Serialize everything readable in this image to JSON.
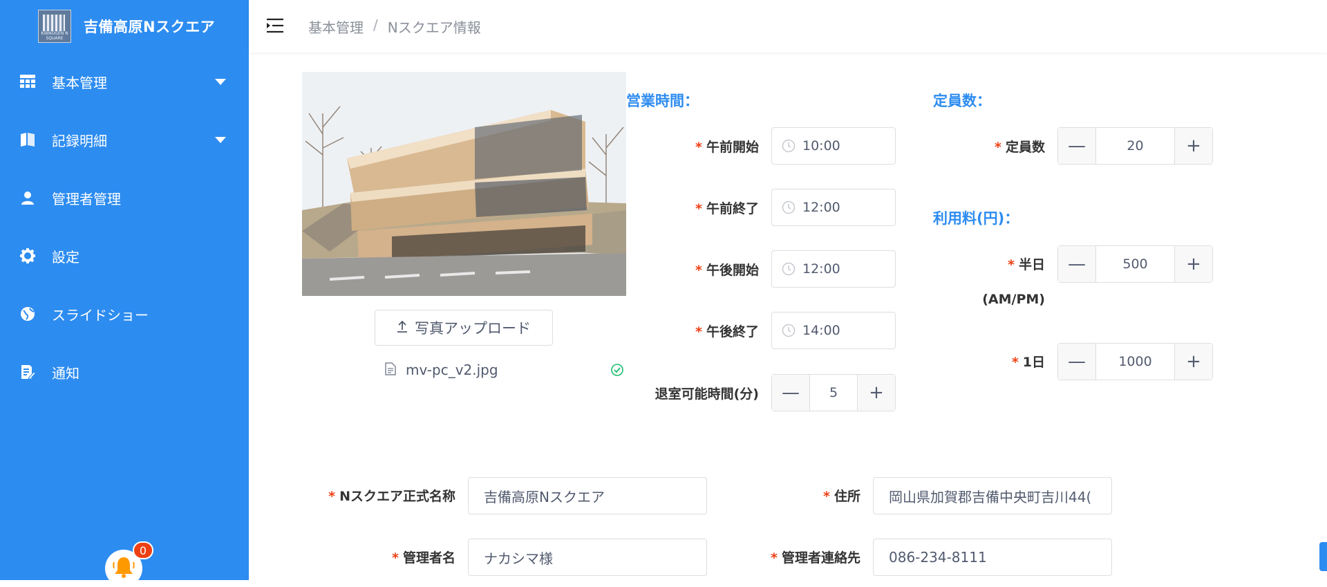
{
  "app": {
    "title": "吉備高原Nスクエア",
    "logo_text": "KIBIKOGEN N SQUARE"
  },
  "sidebar": {
    "items": [
      {
        "label": "基本管理",
        "icon": "grid-icon",
        "expandable": true
      },
      {
        "label": "記録明細",
        "icon": "book-icon",
        "expandable": true
      },
      {
        "label": "管理者管理",
        "icon": "user-icon",
        "expandable": false
      },
      {
        "label": "設定",
        "icon": "gear-icon",
        "expandable": false
      },
      {
        "label": "スライドショー",
        "icon": "globe-icon",
        "expandable": false
      },
      {
        "label": "通知",
        "icon": "document-edit-icon",
        "expandable": false
      }
    ],
    "notification_count": "0"
  },
  "breadcrumb": {
    "root": "基本管理",
    "separator": "/",
    "current": "Nスクエア情報"
  },
  "photo": {
    "upload_label": "写真アップロード",
    "file_name": "mv-pc_v2.jpg"
  },
  "hours": {
    "title": "営業時間：",
    "am_start_label": "午前開始",
    "am_start_value": "10:00",
    "am_end_label": "午前終了",
    "am_end_value": "12:00",
    "pm_start_label": "午後開始",
    "pm_start_value": "12:00",
    "pm_end_label": "午後終了",
    "pm_end_value": "14:00",
    "checkout_label": "退室可能時間(分)",
    "checkout_value": "5"
  },
  "capacity": {
    "title": "定員数：",
    "label": "定員数",
    "value": "20"
  },
  "fees": {
    "title": "利用料(円)：",
    "half_day_label": "半日",
    "half_day_sub": "(AM/PM)",
    "half_day_value": "500",
    "full_day_label": "1日",
    "full_day_value": "1000"
  },
  "info": {
    "official_name_label": "Nスクエア正式名称",
    "official_name_value": "吉備高原Nスクエア",
    "address_label": "住所",
    "address_value": "岡山県加賀郡吉備中央町吉川44(",
    "manager_label": "管理者名",
    "manager_value": "ナカシマ様",
    "contact_label": "管理者連絡先",
    "contact_value": "086-234-8111"
  },
  "stepper": {
    "minus": "—",
    "plus": "+"
  },
  "required_mark": "*",
  "colors": {
    "primary": "#2d8cf0",
    "required": "#ed4014",
    "success": "#19be6b"
  }
}
